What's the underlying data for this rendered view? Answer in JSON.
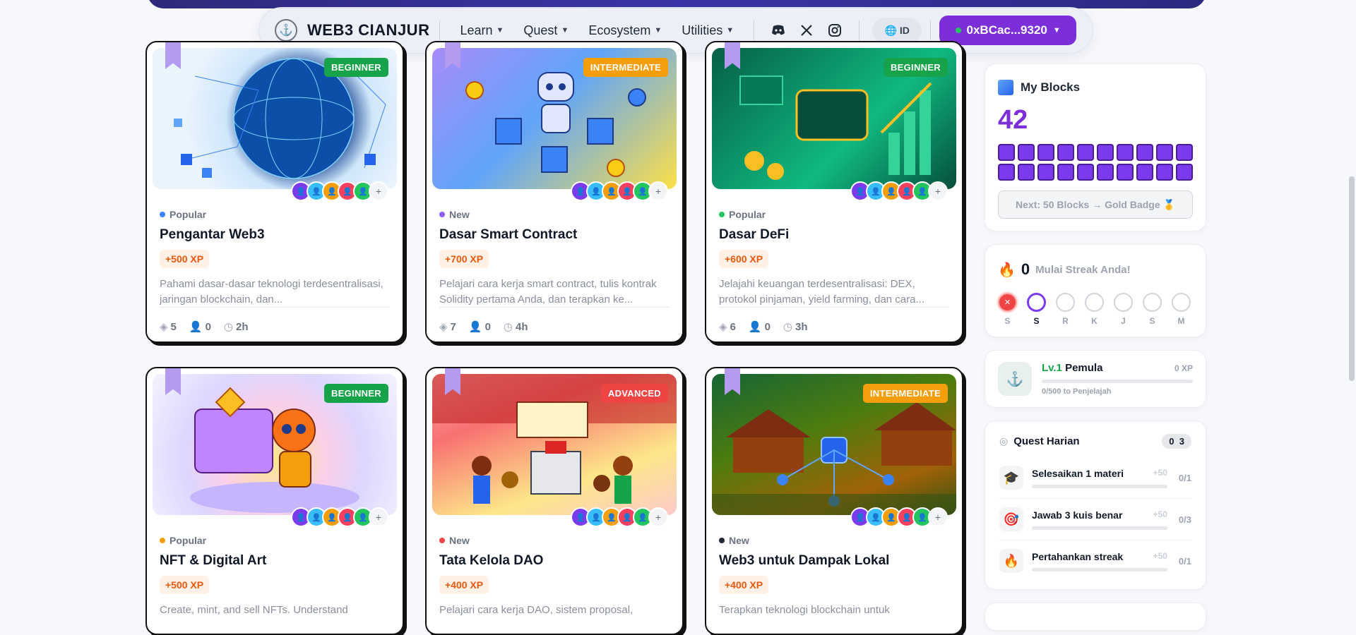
{
  "nav": {
    "brand": "WEB3 CIANJUR",
    "links": [
      {
        "label": "Learn"
      },
      {
        "label": "Quest"
      },
      {
        "label": "Ecosystem"
      },
      {
        "label": "Utilities"
      }
    ],
    "lang": "ID",
    "wallet": "0xBCac...9320"
  },
  "cards": [
    {
      "level": "BEGINNER",
      "tag": "Popular",
      "title": "Pengantar Web3",
      "xp": "+500 XP",
      "desc": "Pahami dasar-dasar teknologi terdesentralisasi, jaringan blockchain, dan...",
      "modules": "5",
      "users": "0",
      "duration": "2h"
    },
    {
      "level": "INTERMEDIATE",
      "tag": "New",
      "title": "Dasar Smart Contract",
      "xp": "+700 XP",
      "desc": "Pelajari cara kerja smart contract, tulis kontrak Solidity pertama Anda, dan terapkan ke...",
      "modules": "7",
      "users": "0",
      "duration": "4h"
    },
    {
      "level": "BEGINNER",
      "tag": "Popular",
      "title": "Dasar DeFi",
      "xp": "+600 XP",
      "desc": "Jelajahi keuangan terdesentralisasi: DEX, protokol pinjaman, yield farming, dan cara...",
      "modules": "6",
      "users": "0",
      "duration": "3h"
    },
    {
      "level": "BEGINNER",
      "tag": "Popular",
      "title": "NFT & Digital Art",
      "xp": "+500 XP",
      "desc": "Create, mint, and sell NFTs. Understand"
    },
    {
      "level": "ADVANCED",
      "tag": "New",
      "title": "Tata Kelola DAO",
      "xp": "+400 XP",
      "desc": "Pelajari cara kerja DAO, sistem proposal,"
    },
    {
      "level": "INTERMEDIATE",
      "tag": "New",
      "title": "Web3 untuk Dampak Lokal",
      "xp": "+400 XP",
      "desc": "Terapkan teknologi blockchain untuk"
    }
  ],
  "blocks": {
    "title": "My Blocks",
    "count": "42",
    "next": "Next: 50 Blocks → Gold Badge 🥇"
  },
  "streak": {
    "count": "0",
    "text": "Mulai Streak Anda!",
    "days": [
      "S",
      "S",
      "R",
      "K",
      "J",
      "S",
      "M"
    ]
  },
  "level": {
    "lv": "Lv.1",
    "name": "Pemula",
    "xp": "0 XP",
    "progress": "0/500 to Penjelajah",
    "progress_fraction": 0
  },
  "quest": {
    "title": "Quest Harian",
    "done": "0",
    "total": "3",
    "items": [
      {
        "name": "Selesaikan 1 materi",
        "pts": "+50",
        "count": "0/1"
      },
      {
        "name": "Jawab 3 kuis benar",
        "pts": "+50",
        "count": "0/3"
      },
      {
        "name": "Pertahankan streak",
        "pts": "+50",
        "count": "0/1"
      }
    ]
  }
}
